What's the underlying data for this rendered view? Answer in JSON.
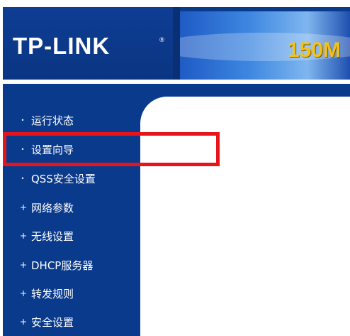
{
  "header": {
    "logo": "TP-LINK",
    "logo_reg": "®",
    "banner_text": "150M"
  },
  "sidebar": {
    "items": [
      {
        "label": "运行状态",
        "bullet": "•"
      },
      {
        "label": "设置向导",
        "bullet": "•"
      },
      {
        "label": "QSS安全设置",
        "bullet": "•"
      },
      {
        "label": "网络参数",
        "bullet": "+"
      },
      {
        "label": "无线设置",
        "bullet": "+"
      },
      {
        "label": "DHCP服务器",
        "bullet": "+"
      },
      {
        "label": "转发规则",
        "bullet": "+"
      },
      {
        "label": "安全设置",
        "bullet": "+"
      }
    ]
  },
  "colors": {
    "brand_blue": "#0a3a8c",
    "highlight_red": "#e8141b",
    "banner_gold": "#f2c21a"
  }
}
